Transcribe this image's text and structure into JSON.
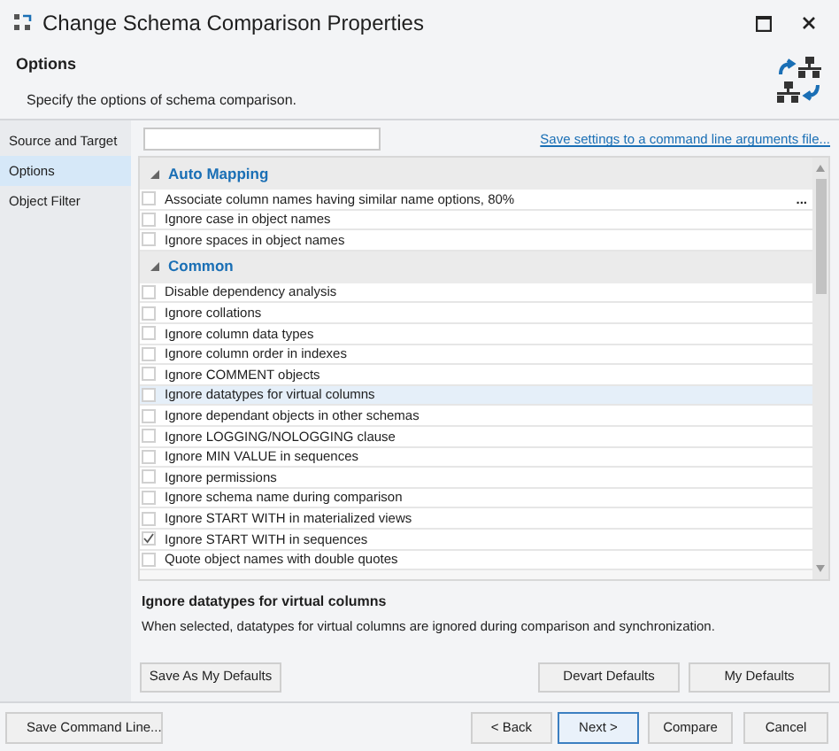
{
  "window": {
    "title": "Change Schema Comparison Properties"
  },
  "header": {
    "title": "Options",
    "description": "Specify the options of schema comparison."
  },
  "sidebar": {
    "items": [
      {
        "label": "Source and Target",
        "selected": false
      },
      {
        "label": "Options",
        "selected": true
      },
      {
        "label": "Object Filter",
        "selected": false
      }
    ]
  },
  "save_settings_link": "Save settings to a command line arguments file...",
  "option_groups": [
    {
      "title": "Auto Mapping",
      "expanded": true,
      "items": [
        {
          "label": "Associate column names having similar name options, 80%",
          "checked": false,
          "selected": false,
          "more_button": "..."
        },
        {
          "label": "Ignore case in object names",
          "checked": false,
          "selected": false
        },
        {
          "label": "Ignore spaces in object names",
          "checked": false,
          "selected": false
        }
      ]
    },
    {
      "title": "Common",
      "expanded": true,
      "items": [
        {
          "label": "Disable dependency analysis",
          "checked": false,
          "selected": false
        },
        {
          "label": "Ignore collations",
          "checked": false,
          "selected": false
        },
        {
          "label": "Ignore column data types",
          "checked": false,
          "selected": false
        },
        {
          "label": "Ignore column order in indexes",
          "checked": false,
          "selected": false
        },
        {
          "label": "Ignore COMMENT objects",
          "checked": false,
          "selected": false
        },
        {
          "label": "Ignore datatypes for virtual columns",
          "checked": false,
          "selected": true
        },
        {
          "label": "Ignore dependant objects in other schemas",
          "checked": false,
          "selected": false
        },
        {
          "label": "Ignore LOGGING/NOLOGGING clause",
          "checked": false,
          "selected": false
        },
        {
          "label": "Ignore MIN VALUE in sequences",
          "checked": false,
          "selected": false
        },
        {
          "label": "Ignore permissions",
          "checked": false,
          "selected": false
        },
        {
          "label": "Ignore schema name during comparison",
          "checked": false,
          "selected": false
        },
        {
          "label": "Ignore START WITH in materialized views",
          "checked": false,
          "selected": false
        },
        {
          "label": "Ignore START WITH in sequences",
          "checked": true,
          "selected": false
        },
        {
          "label": "Quote object names with double quotes",
          "checked": false,
          "selected": false
        }
      ]
    }
  ],
  "description": {
    "title": "Ignore datatypes for virtual columns",
    "text": "When selected, datatypes for virtual columns are ignored during comparison and synchronization."
  },
  "defaults_buttons": {
    "left": "Save As My Defaults",
    "right": [
      "Devart Defaults",
      "My Defaults"
    ]
  },
  "footer": {
    "save_command_line": "Save Command Line...",
    "buttons": [
      {
        "label": "< Back",
        "default": false
      },
      {
        "label": "Next >",
        "default": true
      },
      {
        "label": "Compare",
        "default": false
      },
      {
        "label": "Cancel",
        "default": false
      }
    ]
  }
}
